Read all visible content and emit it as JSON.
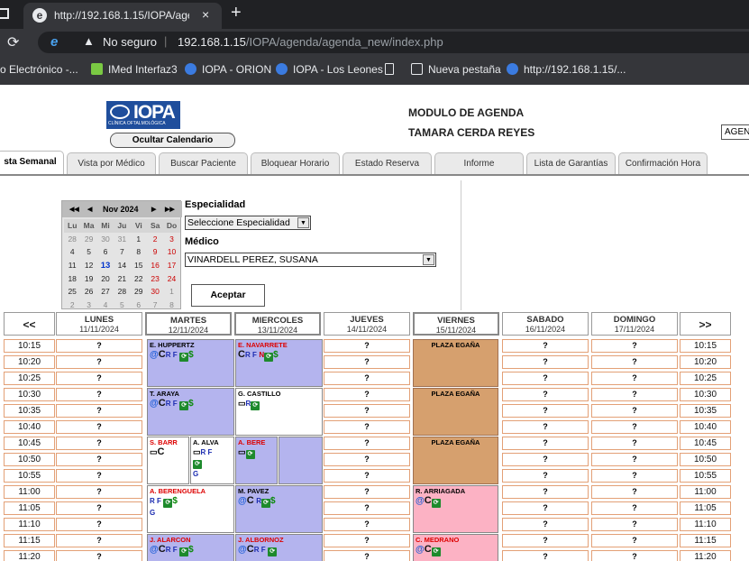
{
  "browser": {
    "tab_title": "http://192.168.1.15/IOPA/agenda/",
    "tab_close": "×",
    "new_tab": "+",
    "security": "No seguro",
    "url_host": "192.168.1.15",
    "url_path": "/IOPA/agenda/agenda_new/index.php",
    "bookmarks": [
      "o Electrónico -...",
      "IMed Interfaz3",
      "IOPA - ORION",
      "IOPA - Los Leones",
      "Nueva pestaña",
      "http://192.168.1.15/..."
    ]
  },
  "header": {
    "logo_text": "IOPA",
    "logo_sub": "CLÍNICA OFTALMOLÓGICA",
    "hide_calendar": "Ocultar Calendario",
    "module": "MODULO DE AGENDA",
    "user": "TAMARA CERDA REYES",
    "agenda_box": "AGEN"
  },
  "tabs": [
    "sta Semanal",
    "Vista por Médico",
    "Buscar Paciente",
    "Bloquear Horario",
    "Estado Reserva",
    "Informe",
    "Lista de Garantías",
    "Confirmación Hora"
  ],
  "calendar": {
    "month": "Nov 2024",
    "nav_prev2": "◀◀",
    "nav_prev": "◀",
    "nav_next": "▶",
    "nav_next2": "▶▶",
    "day_names": [
      "Lu",
      "Ma",
      "Mi",
      "Ju",
      "Vi",
      "Sa",
      "Do"
    ],
    "weeks": [
      [
        "28",
        "29",
        "30",
        "31",
        "1",
        "2",
        "3"
      ],
      [
        "4",
        "5",
        "6",
        "7",
        "8",
        "9",
        "10"
      ],
      [
        "11",
        "12",
        "13",
        "14",
        "15",
        "16",
        "17"
      ],
      [
        "18",
        "19",
        "20",
        "21",
        "22",
        "23",
        "24"
      ],
      [
        "25",
        "26",
        "27",
        "28",
        "29",
        "30",
        "1"
      ],
      [
        "2",
        "3",
        "4",
        "5",
        "6",
        "7",
        "8"
      ]
    ],
    "today": "13"
  },
  "form": {
    "especialidad_label": "Especialidad",
    "especialidad_value": "Seleccione Especialidad",
    "medico_label": "Médico",
    "medico_value": "VINARDELL PEREZ, SUSANA",
    "accept": "Aceptar"
  },
  "week": {
    "prev": "<<",
    "next": ">>",
    "days": [
      {
        "name": "LUNES",
        "date": "11/11/2024"
      },
      {
        "name": "MARTES",
        "date": "12/11/2024"
      },
      {
        "name": "MIERCOLES",
        "date": "13/11/2024"
      },
      {
        "name": "JUEVES",
        "date": "14/11/2024"
      },
      {
        "name": "VIERNES",
        "date": "15/11/2024"
      },
      {
        "name": "SABADO",
        "date": "16/11/2024"
      },
      {
        "name": "DOMINGO",
        "date": "17/11/2024"
      }
    ],
    "times": [
      "10:15",
      "10:20",
      "10:25",
      "10:30",
      "10:35",
      "10:40",
      "10:45",
      "10:50",
      "10:55",
      "11:00",
      "11:05",
      "11:10",
      "11:15",
      "11:20"
    ],
    "empty_mark": "?",
    "blocked_label": "PLAZA EGAÑA",
    "appointments": {
      "hupperz": {
        "name": "E. HUPPERTZ",
        "icons": "@CR F ⟳$"
      },
      "navarrete": {
        "name": "E. NAVARRETE",
        "icons": "CR F N⟳$"
      },
      "araya": {
        "name": "T. ARAYA",
        "icons": "@C R F ⟳$"
      },
      "castillo": {
        "name": "G. CASTILLO",
        "icons": "▭R⟳"
      },
      "barr": {
        "name": "S. BARR",
        "icons": "▭C"
      },
      "alva": {
        "name": "A. ALVA",
        "icons": "▭R F ⟳ G"
      },
      "bere": {
        "name": "A. BERE",
        "icons": "▭⟳"
      },
      "berenguela": {
        "name": "A. BERENGUELA",
        "icons": "R F ⟳$ G"
      },
      "pavez": {
        "name": "M. PAVEZ",
        "icons": "@C R⟳$"
      },
      "arriagada": {
        "name": "R. ARRIAGADA",
        "icons": "@C⟳"
      },
      "alarcon": {
        "name": "J. ALARCON",
        "icons": "@C R F ⟳$"
      },
      "albornoz": {
        "name": "J. ALBORNOZ",
        "icons": "@C R F ⟳"
      },
      "medrano": {
        "name": "C. MEDRANO",
        "icons": "@C⟳"
      }
    }
  }
}
